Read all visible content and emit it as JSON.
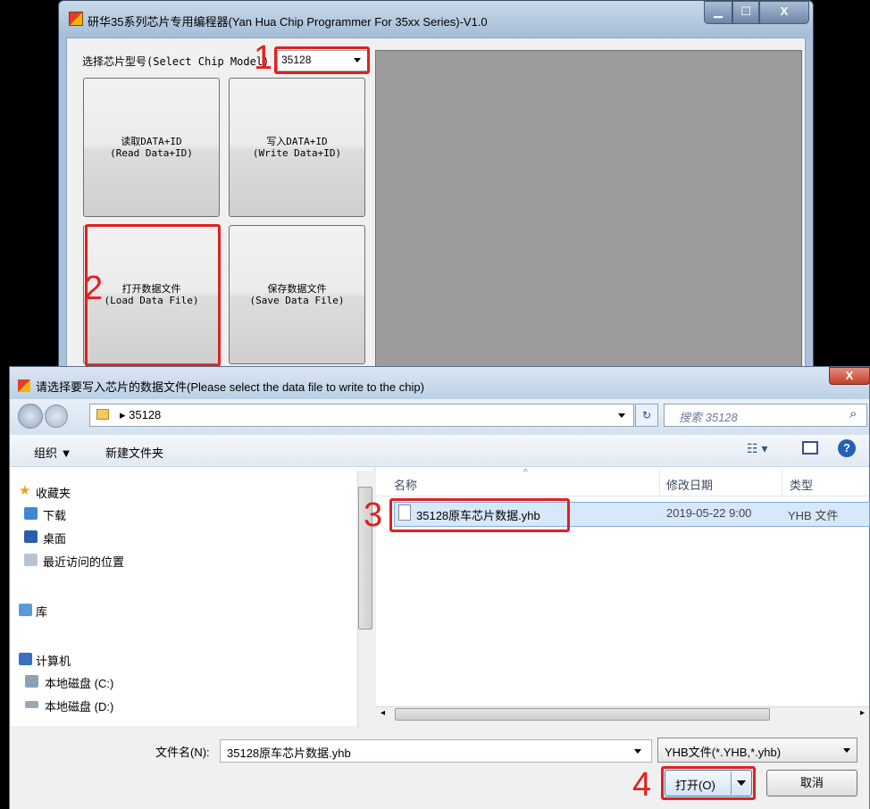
{
  "main_window": {
    "title": "研华35系列芯片专用编程器(Yan Hua Chip Programmer For 35xx Series)-V1.0",
    "controls": {
      "minimize": "▁",
      "maximize": "☐",
      "close": "X"
    },
    "chip_model_label": "选择芯片型号(Select Chip Model)",
    "chip_model_value": "35128",
    "buttons": {
      "read_cn": "读取DATA+ID",
      "read_en": "(Read Data+ID)",
      "write_cn": "写入DATA+ID",
      "write_en": "(Write Data+ID)",
      "load_cn": "打开数据文件",
      "load_en": "(Load Data File)",
      "save_cn": "保存数据文件",
      "save_en": "(Save Data File)"
    }
  },
  "annotations": {
    "step1": "1",
    "step2": "2",
    "step3": "3",
    "step4": "4",
    "color": "#e02020"
  },
  "dialog": {
    "title": "请选择要写入芯片的数据文件(Please select the data file to write to the chip)",
    "close": "X",
    "address": "35128",
    "search_placeholder": "搜索 35128",
    "toolbar": {
      "organize": "组织 ▼",
      "new_folder": "新建文件夹"
    },
    "nav": {
      "favorites": "收藏夹",
      "downloads": "下载",
      "desktop": "桌面",
      "recent": "最近访问的位置",
      "libraries": "库",
      "computer": "计算机",
      "drive_c": "本地磁盘 (C:)",
      "drive_d": "本地磁盘 (D:)"
    },
    "columns": {
      "name": "名称",
      "date": "修改日期",
      "type": "类型"
    },
    "files": [
      {
        "name": "35128原车芯片数据.yhb",
        "date": "2019-05-22 9:00",
        "type": "YHB 文件"
      }
    ],
    "filename_label": "文件名(N):",
    "filename_value": "35128原车芯片数据.yhb",
    "filetype_value": "YHB文件(*.YHB,*.yhb)",
    "open_button": "打开(O)",
    "cancel_button": "取消"
  }
}
